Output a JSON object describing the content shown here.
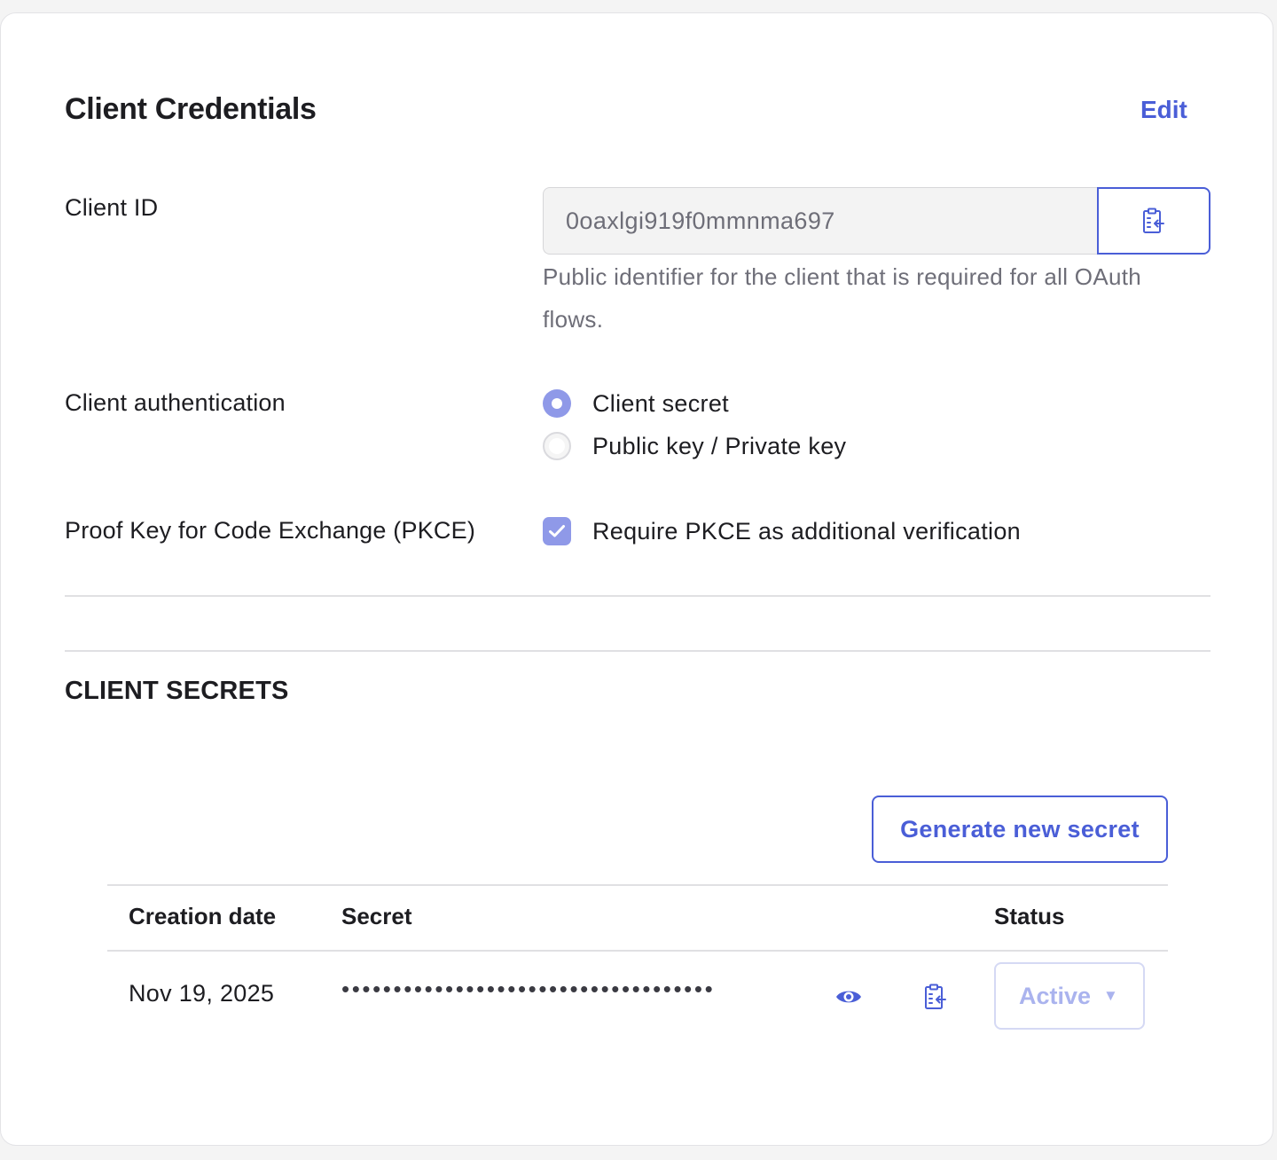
{
  "header": {
    "title": "Client Credentials",
    "edit_label": "Edit"
  },
  "client_id": {
    "label": "Client ID",
    "value": "0oaxlgi919f0mmnma697",
    "hint": "Public identifier for the client that is required for all OAuth flows."
  },
  "client_auth": {
    "label": "Client authentication",
    "options": [
      {
        "label": "Client secret",
        "selected": true
      },
      {
        "label": "Public key / Private key",
        "selected": false
      }
    ]
  },
  "pkce": {
    "label": "Proof Key for Code Exchange (PKCE)",
    "checkbox_label": "Require PKCE as additional verification",
    "checked": true
  },
  "client_secrets": {
    "section_title": "CLIENT SECRETS",
    "generate_label": "Generate new secret",
    "columns": {
      "creation_date": "Creation date",
      "secret": "Secret",
      "status": "Status"
    },
    "rows": [
      {
        "creation_date": "Nov 19, 2025",
        "secret_masked": "••••••••••••••••••••••••••••••••••••",
        "status": "Active"
      }
    ]
  },
  "icons": {
    "copy": "clipboard-copy-icon",
    "reveal": "eye-icon",
    "dropdown": "caret-down-icon",
    "check": "checkmark-icon"
  },
  "colors": {
    "accent": "#4a5ed7",
    "control_fill": "#8f99e8",
    "disabled_text": "#aab3ee",
    "muted_text": "#6e6e78"
  }
}
